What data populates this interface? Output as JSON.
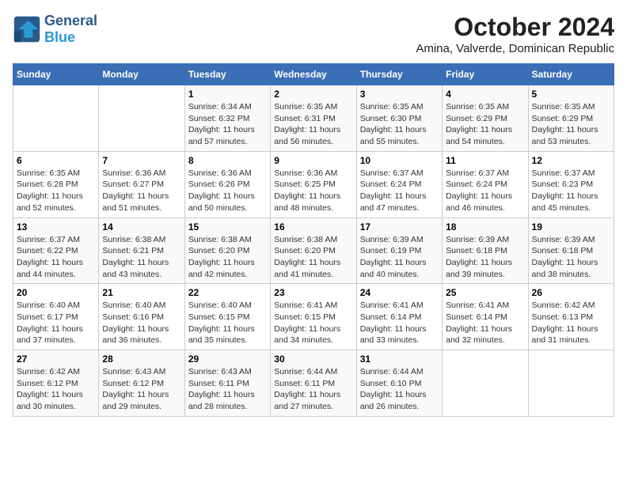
{
  "logo": {
    "general": "General",
    "blue": "Blue"
  },
  "title": "October 2024",
  "subtitle": "Amina, Valverde, Dominican Republic",
  "days_header": [
    "Sunday",
    "Monday",
    "Tuesday",
    "Wednesday",
    "Thursday",
    "Friday",
    "Saturday"
  ],
  "weeks": [
    [
      {
        "day": "",
        "sunrise": "",
        "sunset": "",
        "daylight": ""
      },
      {
        "day": "",
        "sunrise": "",
        "sunset": "",
        "daylight": ""
      },
      {
        "day": "1",
        "sunrise": "Sunrise: 6:34 AM",
        "sunset": "Sunset: 6:32 PM",
        "daylight": "Daylight: 11 hours and 57 minutes."
      },
      {
        "day": "2",
        "sunrise": "Sunrise: 6:35 AM",
        "sunset": "Sunset: 6:31 PM",
        "daylight": "Daylight: 11 hours and 56 minutes."
      },
      {
        "day": "3",
        "sunrise": "Sunrise: 6:35 AM",
        "sunset": "Sunset: 6:30 PM",
        "daylight": "Daylight: 11 hours and 55 minutes."
      },
      {
        "day": "4",
        "sunrise": "Sunrise: 6:35 AM",
        "sunset": "Sunset: 6:29 PM",
        "daylight": "Daylight: 11 hours and 54 minutes."
      },
      {
        "day": "5",
        "sunrise": "Sunrise: 6:35 AM",
        "sunset": "Sunset: 6:29 PM",
        "daylight": "Daylight: 11 hours and 53 minutes."
      }
    ],
    [
      {
        "day": "6",
        "sunrise": "Sunrise: 6:35 AM",
        "sunset": "Sunset: 6:28 PM",
        "daylight": "Daylight: 11 hours and 52 minutes."
      },
      {
        "day": "7",
        "sunrise": "Sunrise: 6:36 AM",
        "sunset": "Sunset: 6:27 PM",
        "daylight": "Daylight: 11 hours and 51 minutes."
      },
      {
        "day": "8",
        "sunrise": "Sunrise: 6:36 AM",
        "sunset": "Sunset: 6:26 PM",
        "daylight": "Daylight: 11 hours and 50 minutes."
      },
      {
        "day": "9",
        "sunrise": "Sunrise: 6:36 AM",
        "sunset": "Sunset: 6:25 PM",
        "daylight": "Daylight: 11 hours and 48 minutes."
      },
      {
        "day": "10",
        "sunrise": "Sunrise: 6:37 AM",
        "sunset": "Sunset: 6:24 PM",
        "daylight": "Daylight: 11 hours and 47 minutes."
      },
      {
        "day": "11",
        "sunrise": "Sunrise: 6:37 AM",
        "sunset": "Sunset: 6:24 PM",
        "daylight": "Daylight: 11 hours and 46 minutes."
      },
      {
        "day": "12",
        "sunrise": "Sunrise: 6:37 AM",
        "sunset": "Sunset: 6:23 PM",
        "daylight": "Daylight: 11 hours and 45 minutes."
      }
    ],
    [
      {
        "day": "13",
        "sunrise": "Sunrise: 6:37 AM",
        "sunset": "Sunset: 6:22 PM",
        "daylight": "Daylight: 11 hours and 44 minutes."
      },
      {
        "day": "14",
        "sunrise": "Sunrise: 6:38 AM",
        "sunset": "Sunset: 6:21 PM",
        "daylight": "Daylight: 11 hours and 43 minutes."
      },
      {
        "day": "15",
        "sunrise": "Sunrise: 6:38 AM",
        "sunset": "Sunset: 6:20 PM",
        "daylight": "Daylight: 11 hours and 42 minutes."
      },
      {
        "day": "16",
        "sunrise": "Sunrise: 6:38 AM",
        "sunset": "Sunset: 6:20 PM",
        "daylight": "Daylight: 11 hours and 41 minutes."
      },
      {
        "day": "17",
        "sunrise": "Sunrise: 6:39 AM",
        "sunset": "Sunset: 6:19 PM",
        "daylight": "Daylight: 11 hours and 40 minutes."
      },
      {
        "day": "18",
        "sunrise": "Sunrise: 6:39 AM",
        "sunset": "Sunset: 6:18 PM",
        "daylight": "Daylight: 11 hours and 39 minutes."
      },
      {
        "day": "19",
        "sunrise": "Sunrise: 6:39 AM",
        "sunset": "Sunset: 6:18 PM",
        "daylight": "Daylight: 11 hours and 38 minutes."
      }
    ],
    [
      {
        "day": "20",
        "sunrise": "Sunrise: 6:40 AM",
        "sunset": "Sunset: 6:17 PM",
        "daylight": "Daylight: 11 hours and 37 minutes."
      },
      {
        "day": "21",
        "sunrise": "Sunrise: 6:40 AM",
        "sunset": "Sunset: 6:16 PM",
        "daylight": "Daylight: 11 hours and 36 minutes."
      },
      {
        "day": "22",
        "sunrise": "Sunrise: 6:40 AM",
        "sunset": "Sunset: 6:15 PM",
        "daylight": "Daylight: 11 hours and 35 minutes."
      },
      {
        "day": "23",
        "sunrise": "Sunrise: 6:41 AM",
        "sunset": "Sunset: 6:15 PM",
        "daylight": "Daylight: 11 hours and 34 minutes."
      },
      {
        "day": "24",
        "sunrise": "Sunrise: 6:41 AM",
        "sunset": "Sunset: 6:14 PM",
        "daylight": "Daylight: 11 hours and 33 minutes."
      },
      {
        "day": "25",
        "sunrise": "Sunrise: 6:41 AM",
        "sunset": "Sunset: 6:14 PM",
        "daylight": "Daylight: 11 hours and 32 minutes."
      },
      {
        "day": "26",
        "sunrise": "Sunrise: 6:42 AM",
        "sunset": "Sunset: 6:13 PM",
        "daylight": "Daylight: 11 hours and 31 minutes."
      }
    ],
    [
      {
        "day": "27",
        "sunrise": "Sunrise: 6:42 AM",
        "sunset": "Sunset: 6:12 PM",
        "daylight": "Daylight: 11 hours and 30 minutes."
      },
      {
        "day": "28",
        "sunrise": "Sunrise: 6:43 AM",
        "sunset": "Sunset: 6:12 PM",
        "daylight": "Daylight: 11 hours and 29 minutes."
      },
      {
        "day": "29",
        "sunrise": "Sunrise: 6:43 AM",
        "sunset": "Sunset: 6:11 PM",
        "daylight": "Daylight: 11 hours and 28 minutes."
      },
      {
        "day": "30",
        "sunrise": "Sunrise: 6:44 AM",
        "sunset": "Sunset: 6:11 PM",
        "daylight": "Daylight: 11 hours and 27 minutes."
      },
      {
        "day": "31",
        "sunrise": "Sunrise: 6:44 AM",
        "sunset": "Sunset: 6:10 PM",
        "daylight": "Daylight: 11 hours and 26 minutes."
      },
      {
        "day": "",
        "sunrise": "",
        "sunset": "",
        "daylight": ""
      },
      {
        "day": "",
        "sunrise": "",
        "sunset": "",
        "daylight": ""
      }
    ]
  ]
}
